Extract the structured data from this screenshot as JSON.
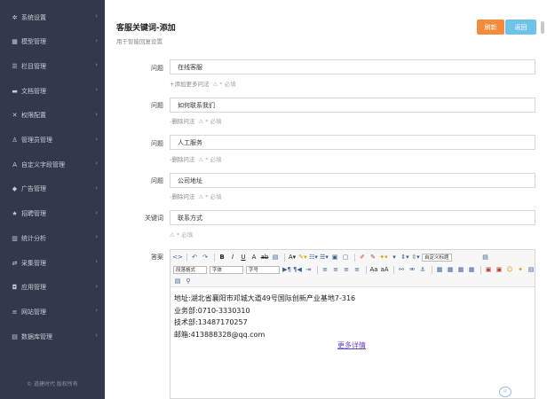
{
  "sidebar": {
    "items": [
      {
        "label": "系统设置",
        "icon": "gear-icon",
        "glyph": "✲"
      },
      {
        "label": "模型管理",
        "icon": "model-icon",
        "glyph": "▦"
      },
      {
        "label": "栏目管理",
        "icon": "column-icon",
        "glyph": "☰"
      },
      {
        "label": "文档管理",
        "icon": "folder-icon",
        "glyph": "▬"
      },
      {
        "label": "权限配置",
        "icon": "permission-icon",
        "glyph": "✕"
      },
      {
        "label": "管理员管理",
        "icon": "admin-icon",
        "glyph": "♙"
      },
      {
        "label": "自定义字段管理",
        "icon": "font-icon",
        "glyph": "A"
      },
      {
        "label": "广告管理",
        "icon": "tag-icon",
        "glyph": "◆"
      },
      {
        "label": "招聘管理",
        "icon": "star-icon",
        "glyph": "★"
      },
      {
        "label": "统计分析",
        "icon": "chart-icon",
        "glyph": "▥"
      },
      {
        "label": "采集管理",
        "icon": "exchange-icon",
        "glyph": "⇄"
      },
      {
        "label": "应用管理",
        "icon": "app-icon",
        "glyph": "◘"
      },
      {
        "label": "网站管理",
        "icon": "site-icon",
        "glyph": "≡"
      },
      {
        "label": "数据库管理",
        "icon": "database-icon",
        "glyph": "▤"
      }
    ],
    "footer": "© 道建时代 版权所有"
  },
  "header": {
    "title": "客服关键词-添加",
    "subtitle": "用于智能回复设置",
    "refresh_label": "刷新",
    "back_label": "返回"
  },
  "form": {
    "q1": {
      "label": "问题",
      "value": "在线客服",
      "hint": "+添加更多问法",
      "req": "* 必填"
    },
    "q2": {
      "label": "问题",
      "value": "如何联系我们",
      "hint": "-删除问法",
      "req": "* 必填"
    },
    "q3": {
      "label": "问题",
      "value": "人工服务",
      "hint": "-删除问法",
      "req": "* 必填"
    },
    "q4": {
      "label": "问题",
      "value": "公司地址",
      "hint": "-删除问法",
      "req": "* 必填"
    },
    "keyword": {
      "label": "关键词",
      "value": "联系方式",
      "req": "* 必填"
    },
    "answer": {
      "label": "答案"
    }
  },
  "editor": {
    "font_family_label": "自定义标题",
    "paragraph_label": "段落格式",
    "font_label": "字体",
    "size_label": "字号",
    "lines": [
      "地址:湖北省襄阳市邓城大道49号国际创新产业基地7-316",
      "业务部:0710-3330310",
      "技术部:13487170257",
      "邮箱:413888328@qq.com"
    ],
    "more_link": "更多详情"
  }
}
